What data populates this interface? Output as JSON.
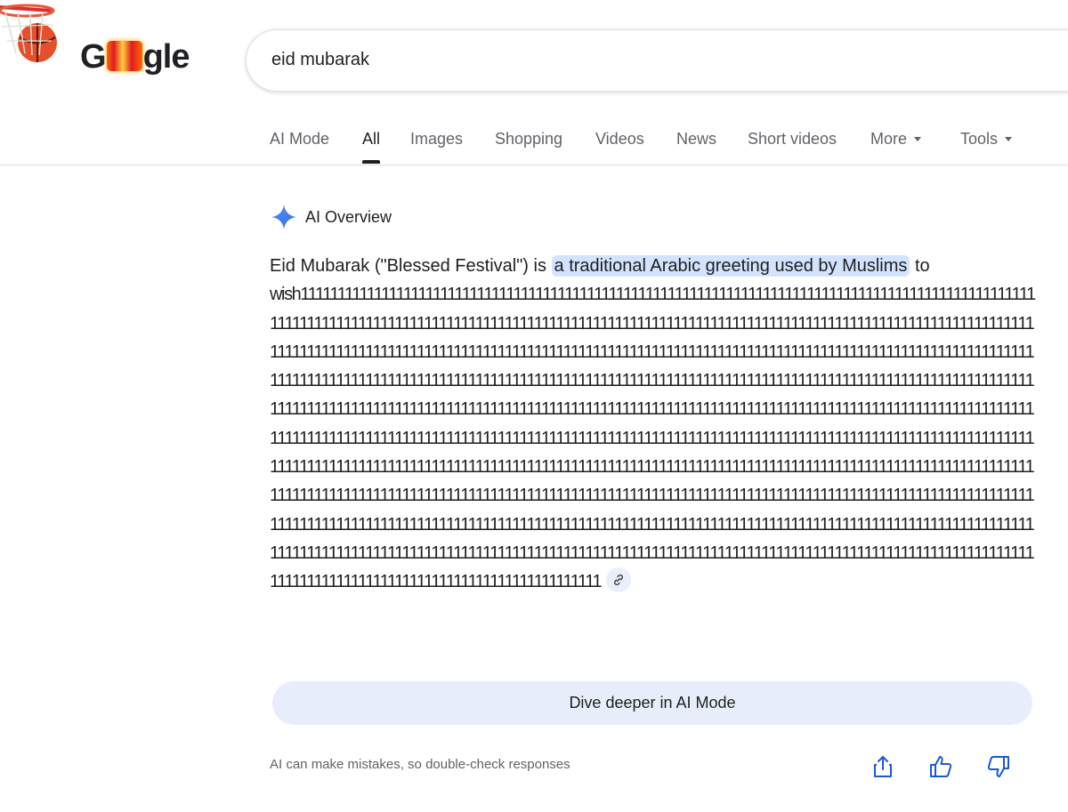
{
  "logo": {
    "text_start": "G",
    "text_end": "gle"
  },
  "search": {
    "query": "eid mubarak"
  },
  "tabs": [
    {
      "label": "AI Mode",
      "active": false
    },
    {
      "label": "All",
      "active": true
    },
    {
      "label": "Images",
      "active": false
    },
    {
      "label": "Shopping",
      "active": false
    },
    {
      "label": "Videos",
      "active": false
    },
    {
      "label": "News",
      "active": false
    },
    {
      "label": "Short videos",
      "active": false
    },
    {
      "label": "More",
      "active": false
    },
    {
      "label": "Tools",
      "active": false
    }
  ],
  "ai_overview": {
    "title": "AI Overview",
    "lead": "Eid Mubarak (\"Blessed Festival\") is",
    "highlight": "a traditional Arabic greeting used by Muslims",
    "after": "to",
    "body": "wish1111111111111111111111111111111111111111111111111111111111111111111111111111111111111111111111111111111111111111111111111111111111111111111111111111111111111111111111111111111111111111111111111111111111111111111111111111111111111111111111111111111111111111111111111111111111111111111111111111111111111111111111111111111111111111111111111111111111111111111111111111111111111111111111111111111111111111111111111111111111111111111111111111111111111111111111111111111111111111111111111111111111111111111111111111111111111111111111111111111111111111111111111111111111111111111111111111111111111111111111111111111111111111111111111111111111111111111111111111111111111111111111111111111111111111111111111111111111111111111111111111111111111111111111111111111111111111111111111111111111111111111111111111111111111111111111111111111111111111111111111111111111111111111111111111111111111111111111111111111111111111111111111111111111111111111111111111111111111111111111111111111111111111111111111111111111111111111111111111111111111111111111111111111111111111111111111111111111111111111111111",
    "dive_button": "Dive deeper in AI Mode",
    "disclaimer": "AI can make mistakes, so double-check responses"
  },
  "icons": {
    "sparkle": "ai-sparkle-icon",
    "link": "link-icon",
    "share": "share-icon",
    "thumbs_up": "thumbs-up-icon",
    "thumbs_down": "thumbs-down-icon"
  },
  "colors": {
    "highlight": "#d3e3fd",
    "accent_blue": "#4285f4",
    "dive_bg": "#e8edfb"
  }
}
